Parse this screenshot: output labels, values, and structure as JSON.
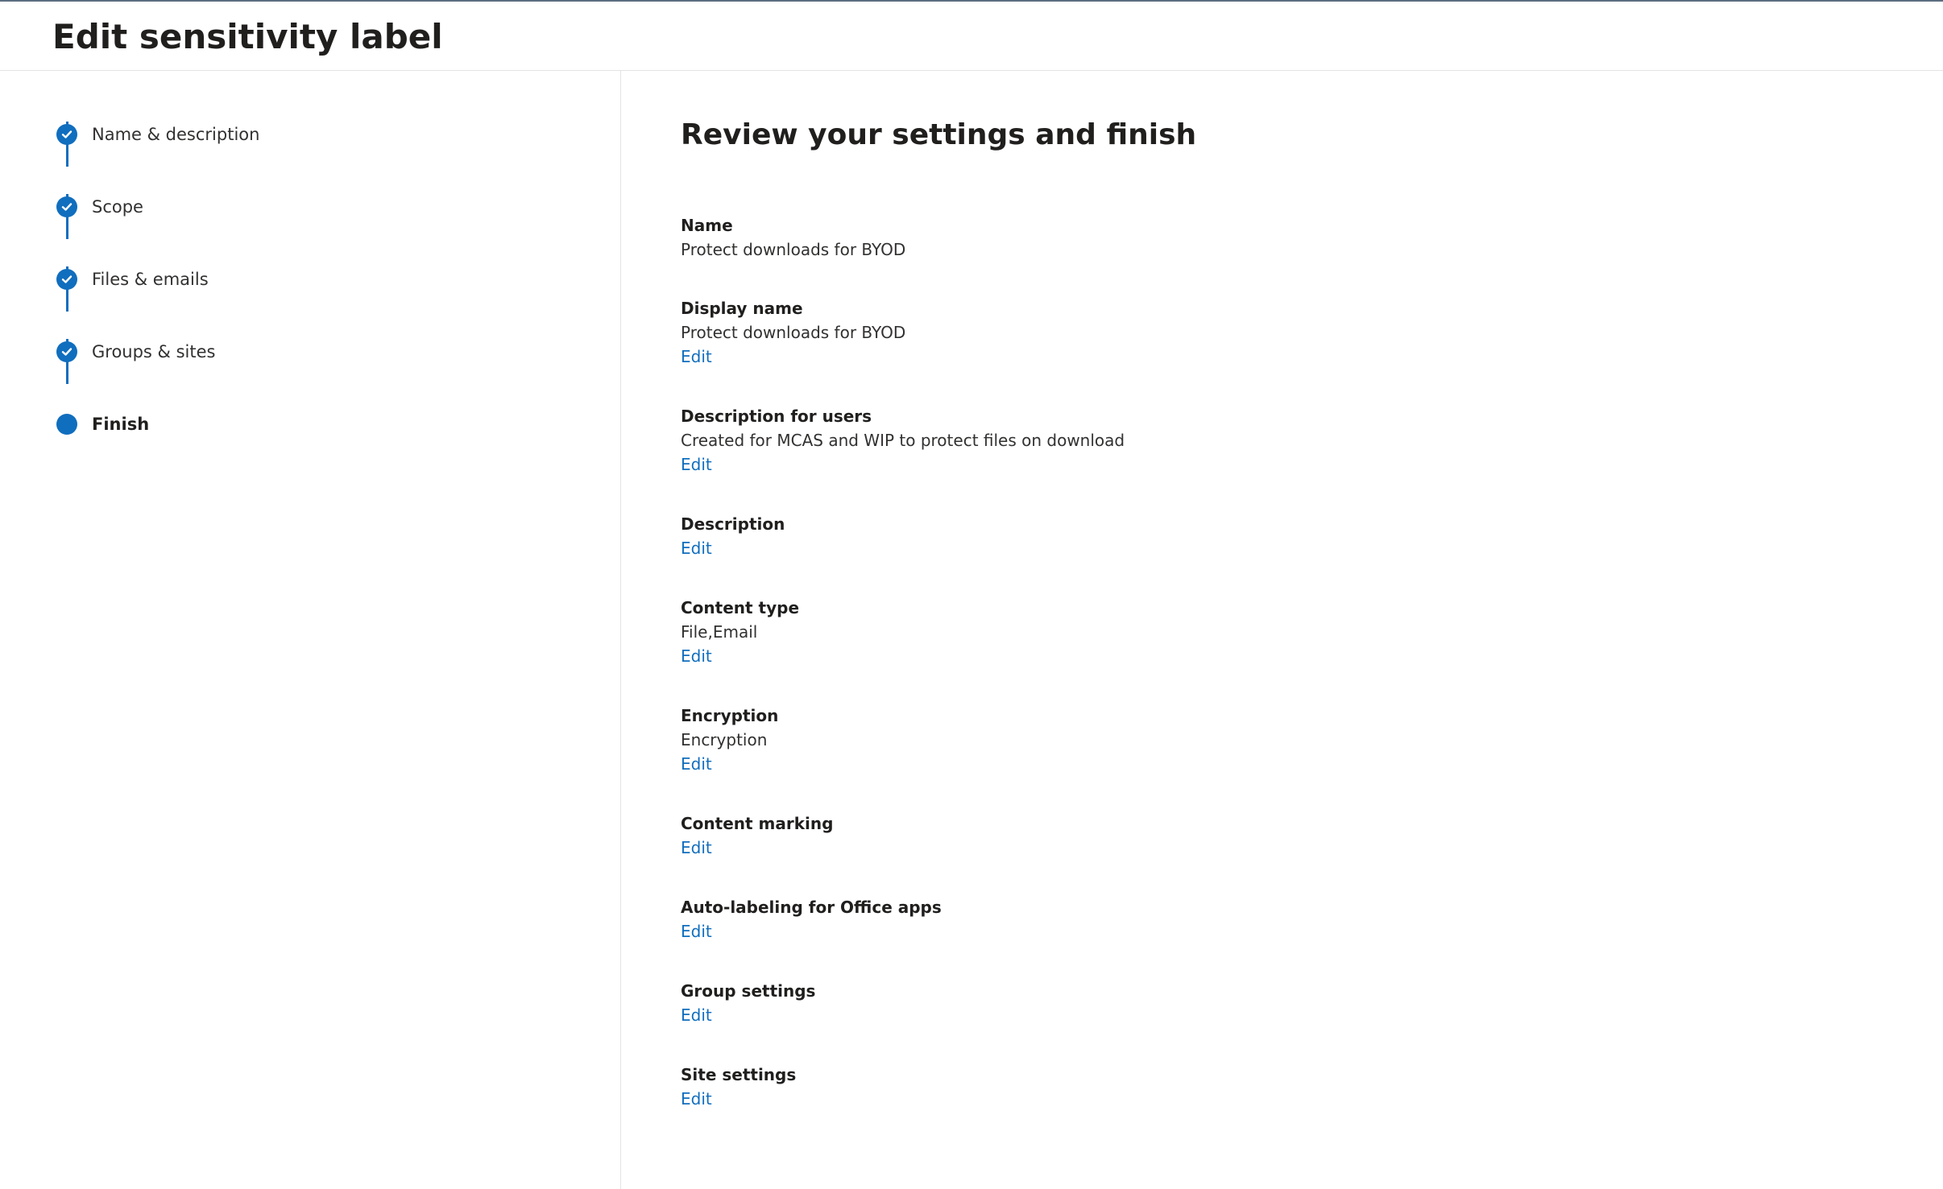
{
  "page": {
    "title": "Edit sensitivity label"
  },
  "steps": [
    {
      "label": "Name & description",
      "status": "completed"
    },
    {
      "label": "Scope",
      "status": "completed"
    },
    {
      "label": "Files & emails",
      "status": "completed"
    },
    {
      "label": "Groups & sites",
      "status": "completed"
    },
    {
      "label": "Finish",
      "status": "current"
    }
  ],
  "review": {
    "heading": "Review your settings and finish",
    "edit_label": "Edit",
    "fields": [
      {
        "label": "Name",
        "value": "Protect downloads for BYOD"
      },
      {
        "label": "Display name",
        "value": "Protect downloads for BYOD",
        "edit": "Edit"
      },
      {
        "label": "Description for users",
        "value": "Created for MCAS and WIP to protect files on download",
        "edit": "Edit"
      },
      {
        "label": "Description",
        "edit": "Edit"
      },
      {
        "label": "Content type",
        "value": "File,Email",
        "edit": "Edit"
      },
      {
        "label": "Encryption",
        "value": "Encryption",
        "edit": "Edit"
      },
      {
        "label": "Content marking",
        "edit": "Edit"
      },
      {
        "label": "Auto-labeling for Office apps",
        "edit": "Edit"
      },
      {
        "label": "Group settings",
        "edit": "Edit"
      },
      {
        "label": "Site settings",
        "edit": "Edit"
      }
    ]
  },
  "colors": {
    "accent": "#106ebe",
    "text": "#323130",
    "heading": "#201f1e",
    "divider": "#e4e4e4"
  }
}
